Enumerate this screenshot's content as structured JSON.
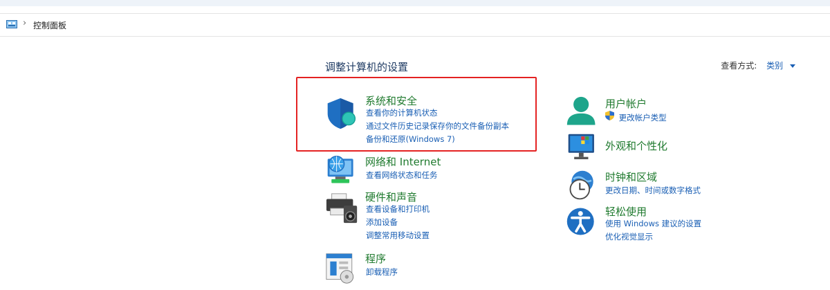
{
  "breadcrumb": {
    "label": "控制面板"
  },
  "main": {
    "heading": "调整计算机的设置",
    "view_by_label": "查看方式:",
    "view_by_value": "类别"
  },
  "categories_left": [
    {
      "title": "系统和安全",
      "icon": "shield-icon",
      "links": [
        "查看你的计算机状态",
        "通过文件历史记录保存你的文件备份副本",
        "备份和还原(Windows 7)"
      ]
    },
    {
      "title": "网络和 Internet",
      "icon": "network-globe-icon",
      "links": [
        "查看网络状态和任务"
      ]
    },
    {
      "title": "硬件和声音",
      "icon": "printer-speaker-icon",
      "links": [
        "查看设备和打印机",
        "添加设备",
        "调整常用移动设置"
      ]
    },
    {
      "title": "程序",
      "icon": "programs-icon",
      "links": [
        "卸载程序"
      ]
    }
  ],
  "categories_right": [
    {
      "title": "用户帐户",
      "icon": "user-icon",
      "links": [
        "更改帐户类型"
      ]
    },
    {
      "title": "外观和个性化",
      "icon": "monitor-icon",
      "links": []
    },
    {
      "title": "时钟和区域",
      "icon": "clock-globe-icon",
      "links": [
        "更改日期、时间或数字格式"
      ]
    },
    {
      "title": "轻松使用",
      "icon": "accessibility-icon",
      "links": [
        "使用 Windows 建议的设置",
        "优化视觉显示"
      ]
    }
  ],
  "colors": {
    "title_green": "#1f7a2e",
    "link_blue": "#1a5fb4",
    "highlight_red": "#e42222"
  }
}
